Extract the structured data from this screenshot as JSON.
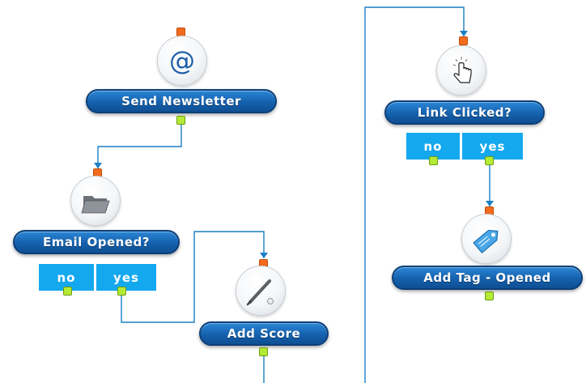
{
  "workflow": {
    "nodes": {
      "send_newsletter": {
        "label": "Send Newsletter",
        "icon": "at-sign-icon"
      },
      "email_opened": {
        "label": "Email Opened?",
        "icon": "folder-icon",
        "branches": {
          "no": "no",
          "yes": "yes"
        }
      },
      "add_score": {
        "label": "Add Score",
        "icon": "baseball-bat-icon"
      },
      "link_clicked": {
        "label": "Link Clicked?",
        "icon": "hand-pointer-click-icon",
        "branches": {
          "no": "no",
          "yes": "yes"
        }
      },
      "add_tag_opened": {
        "label": "Add Tag - Opened",
        "icon": "tag-icon"
      }
    }
  },
  "colors": {
    "pill": "#1561ad",
    "branch": "#14a8ef",
    "input_port": "#f26b1d",
    "output_port": "#b4ea35",
    "connector": "#1a7fc4"
  }
}
